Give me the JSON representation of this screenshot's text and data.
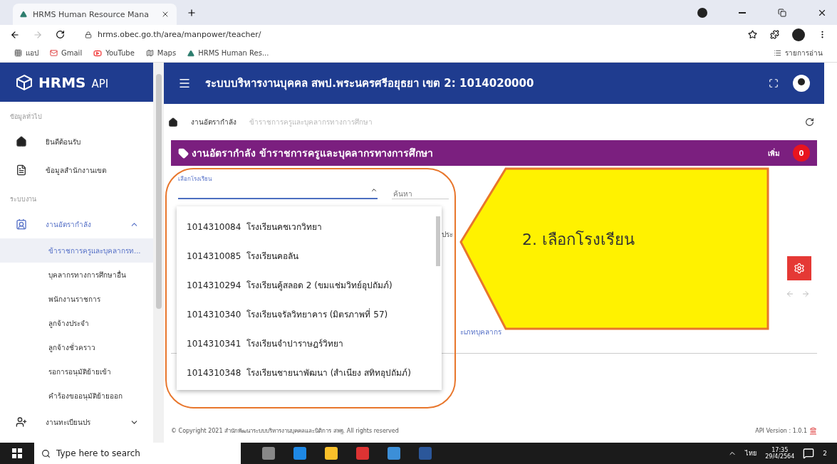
{
  "browser": {
    "tab_title": "HRMS Human Resource Mana",
    "url": "hrms.obec.go.th/area/manpower/teacher/",
    "bookmarks": [
      {
        "kind": "apps",
        "label": "แอป"
      },
      {
        "kind": "gmail",
        "label": "Gmail"
      },
      {
        "kind": "youtube",
        "label": "YouTube"
      },
      {
        "kind": "maps",
        "label": "Maps"
      },
      {
        "kind": "hrms",
        "label": "HRMS Human Res..."
      }
    ],
    "reading_list": "รายการอ่าน"
  },
  "sidebar": {
    "logo": "HRMS",
    "logo_suffix": "API",
    "sections": [
      {
        "title": "ข้อมูลทั่วไป",
        "items": [
          {
            "kind": "home",
            "label": "ยินดีต้อนรับ",
            "selected": false
          },
          {
            "kind": "doc",
            "label": "ข้อมูลสำนักงานเขต",
            "selected": false
          }
        ]
      },
      {
        "title": "ระบบงาน",
        "items": [
          {
            "kind": "badge",
            "label": "งานอัตรากำลัง",
            "expanded": true,
            "children": [
              {
                "label": "ข้าราชการครูและบุคลากรท...",
                "selected": true
              },
              {
                "label": "บุคลากรทางการศึกษาอื่น",
                "selected": false
              },
              {
                "label": "พนักงานราชการ",
                "selected": false
              },
              {
                "label": "ลูกจ้างประจำ",
                "selected": false
              },
              {
                "label": "ลูกจ้างชั่วคราว",
                "selected": false
              },
              {
                "label": "รอการอนุมัติย้ายเข้า",
                "selected": false
              },
              {
                "label": "คำร้องขออนุมัติย้ายออก",
                "selected": false
              }
            ]
          },
          {
            "kind": "user-add",
            "label": "งานทะเบียนปร",
            "expanded": false
          }
        ]
      }
    ]
  },
  "header": {
    "title": "ระบบบริหารงานบุคคล สพป.พระนครศรีอยุธยา เขต 2: 1014020000"
  },
  "breadcrumb": [
    "งานอัตรากำลัง",
    "ข้าราชการครูและบุคลากรทางการศึกษา"
  ],
  "card": {
    "title": "งานอัตรากำลัง ข้าราชการครูและบุคลากรทางการศึกษา",
    "add_label": "เพิ่ม",
    "count": "0",
    "select": {
      "label": "เลือกโรงเรียน",
      "expanded": true
    },
    "search": {
      "placeholder": "ค้นหา"
    },
    "partial_texts": [
      "ประ",
      "ะเภทบุคลากร"
    ]
  },
  "dropdown": [
    {
      "code": "1014310084",
      "name": "โรงเรียนคชเวกวิทยา"
    },
    {
      "code": "1014310085",
      "name": "โรงเรียนคอลัน"
    },
    {
      "code": "1014310294",
      "name": "โรงเรียนคู้สลอด 2 (ขมแช่มวิทย์อุปถัมภ์)"
    },
    {
      "code": "1014310340",
      "name": "โรงเรียนจรัลวิทยาคาร (มิตรภาพที่ 57)"
    },
    {
      "code": "1014310341",
      "name": "โรงเรียนจำปาราษฎร์วิทยา"
    },
    {
      "code": "1014310348",
      "name": "โรงเรียนชายนาพัฒนา (สำเนียง สทิทอุปถัมภ์)"
    }
  ],
  "callout": "2. เลือกโรงเรียน",
  "footer": {
    "copyright": "© Copyright 2021 สำนักพัฒนาระบบบริหารงานบุคคลและนิติการ สพฐ. All rights reserved",
    "version": "API Version : 1.0.1"
  },
  "taskbar": {
    "search": "Type here to search",
    "language": "ไทย",
    "time": "17:35",
    "date": "29/4/2564",
    "notifications": "2"
  }
}
